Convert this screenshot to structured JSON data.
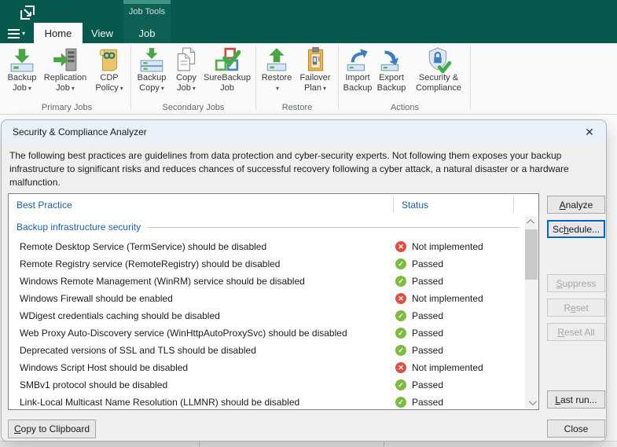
{
  "colors": {
    "ribbon_green": "#07594e",
    "contextual_green": "#0e6054",
    "contextual_accent": "#3f9488",
    "header_blue": "#1b5fa8",
    "passed_green": "#7dbb42",
    "failed_red": "#dd5145",
    "focus_blue": "#0067c0"
  },
  "ribbon": {
    "contextual_group_label": "Job Tools",
    "tabs": {
      "home": "Home",
      "view": "View",
      "job": "Job"
    },
    "groups": [
      {
        "label": "Primary Jobs",
        "buttons": [
          {
            "line1": "Backup",
            "line2": "Job",
            "dropdown": true,
            "icon": "backup-job-icon"
          },
          {
            "line1": "Replication",
            "line2": "Job",
            "dropdown": true,
            "icon": "replication-job-icon"
          },
          {
            "line1": "CDP",
            "line2": "Policy",
            "dropdown": true,
            "icon": "cdp-policy-icon"
          }
        ]
      },
      {
        "label": "Secondary Jobs",
        "buttons": [
          {
            "line1": "Backup",
            "line2": "Copy",
            "dropdown": true,
            "icon": "backup-copy-icon"
          },
          {
            "line1": "Copy",
            "line2": "Job",
            "dropdown": true,
            "icon": "copy-job-icon"
          },
          {
            "line1": "SureBackup",
            "line2": "Job",
            "dropdown": false,
            "icon": "surebackup-job-icon"
          }
        ]
      },
      {
        "label": "Restore",
        "buttons": [
          {
            "line1": "Restore",
            "line2": "",
            "dropdown": true,
            "icon": "restore-icon"
          },
          {
            "line1": "Failover",
            "line2": "Plan",
            "dropdown": true,
            "icon": "failover-plan-icon"
          }
        ]
      },
      {
        "label": "Actions",
        "buttons": [
          {
            "line1": "Import",
            "line2": "Backup",
            "dropdown": false,
            "icon": "import-backup-icon"
          },
          {
            "line1": "Export",
            "line2": "Backup",
            "dropdown": false,
            "icon": "export-backup-icon"
          },
          {
            "line1": "Security &",
            "line2": "Compliance",
            "dropdown": false,
            "icon": "security-compliance-icon"
          }
        ]
      }
    ]
  },
  "dialog": {
    "title": "Security & Compliance Analyzer",
    "description": "The following best practices are guidelines from data protection and cyber-security experts. Not following them exposes your backup infrastructure to significant risks and reduces chances of successful recovery following a cyber attack, a natural disaster or a hardware malfunction.",
    "table": {
      "columns": [
        "Best Practice",
        "Status"
      ],
      "group": "Backup infrastructure security",
      "rows": [
        {
          "practice": "Remote Desktop Service (TermService) should be disabled",
          "status": "Not implemented",
          "passed": false
        },
        {
          "practice": "Remote Registry service (RemoteRegistry) should be disabled",
          "status": "Passed",
          "passed": true
        },
        {
          "practice": "Windows Remote Management (WinRM) service should be disabled",
          "status": "Passed",
          "passed": true
        },
        {
          "practice": "Windows Firewall should be enabled",
          "status": "Not implemented",
          "passed": false
        },
        {
          "practice": "WDigest credentials caching should be disabled",
          "status": "Passed",
          "passed": true
        },
        {
          "practice": "Web Proxy Auto-Discovery service (WinHttpAutoProxySvc) should be disabled",
          "status": "Passed",
          "passed": true
        },
        {
          "practice": "Deprecated versions of SSL and TLS should be disabled",
          "status": "Passed",
          "passed": true
        },
        {
          "practice": "Windows Script Host should be disabled",
          "status": "Not implemented",
          "passed": false
        },
        {
          "practice": "SMBv1 protocol should be disabled",
          "status": "Passed",
          "passed": true
        },
        {
          "practice": "Link-Local Multicast Name Resolution (LLMNR) should be disabled",
          "status": "Passed",
          "passed": true
        }
      ]
    },
    "buttons": {
      "analyze": {
        "label": "Analyze",
        "u": 0
      },
      "schedule": {
        "label": "Schedule...",
        "u": 2
      },
      "suppress": {
        "label": "Suppress",
        "u": 0
      },
      "reset": {
        "label": "Reset",
        "u": 1
      },
      "reset_all": {
        "label": "Reset All",
        "u": 0
      },
      "last_run": {
        "label": "Last run...",
        "u": 0
      },
      "close": {
        "label": "Close",
        "u": -1
      },
      "copy": {
        "label": "Copy to Clipboard",
        "u": 0
      }
    }
  }
}
